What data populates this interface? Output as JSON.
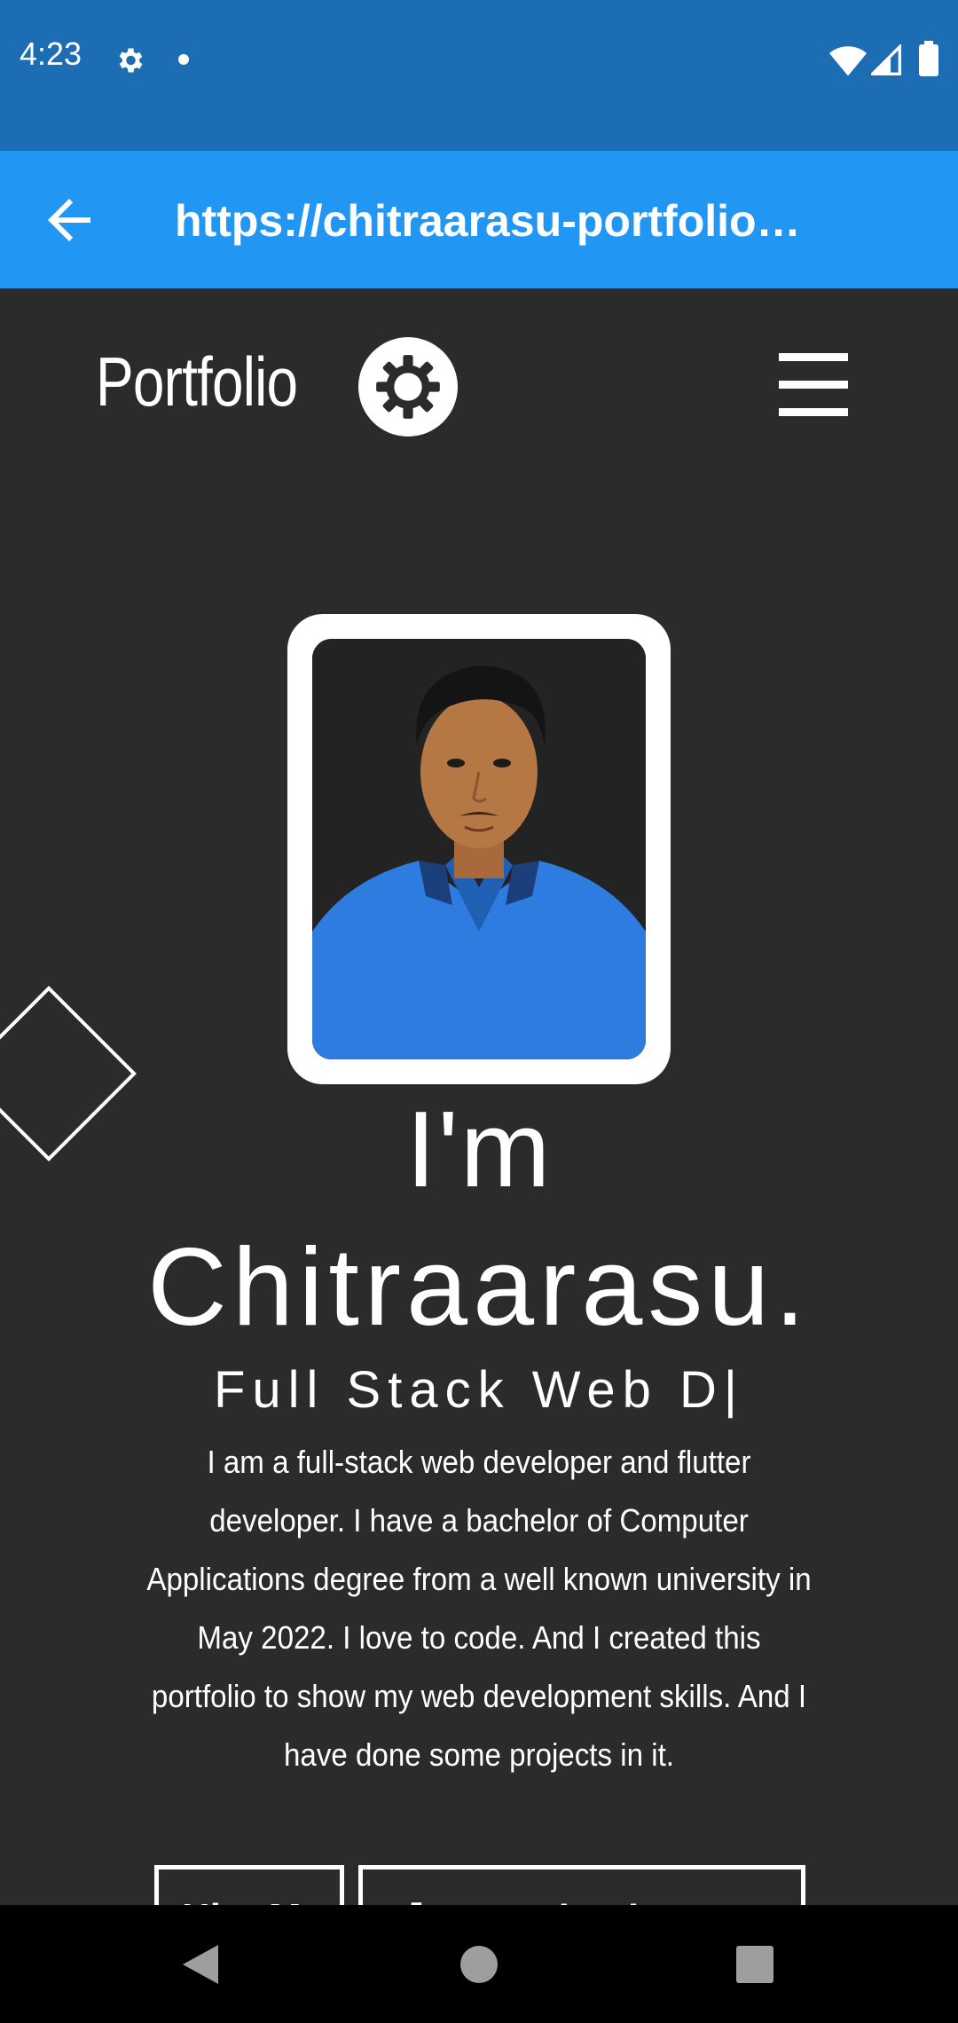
{
  "status_bar": {
    "time": "4:23",
    "icons": [
      "settings-gear-icon",
      "notification-dot-icon",
      "wifi-icon",
      "cell-signal-icon",
      "battery-icon"
    ]
  },
  "browser": {
    "back_icon": "arrow-left-icon",
    "url": "https://chitraarasu-portfolio…",
    "toolbar_color": "#2196f3",
    "status_color": "#1d6db4"
  },
  "header": {
    "brand": "Portfolio",
    "theme_icon": "sun-gear-icon",
    "menu_icon": "hamburger-menu-icon"
  },
  "hero": {
    "greeting": "I'm",
    "name": "Chitraarasu.",
    "role": "Full Stack Web D|",
    "bio": "I am a full-stack web developer and flutter developer. I have a bachelor of Computer Applications degree from a well known university in May 2022. I love to code. And I created this portfolio to show my web development skills. And I have done some projects in it."
  },
  "buttons": {
    "hire": "Hire Me",
    "resume": "Download Resume",
    "resume_icon": "download-icon"
  },
  "colors": {
    "page_background": "#2b2b2b",
    "text": "#ffffff"
  }
}
